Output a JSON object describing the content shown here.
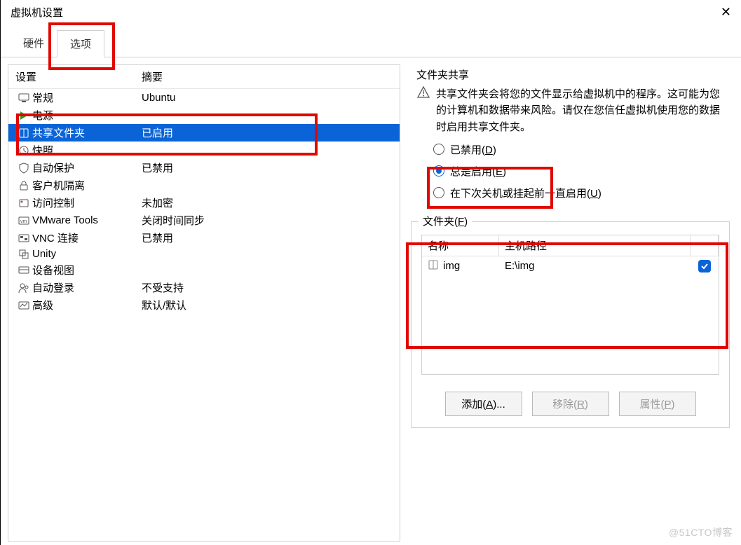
{
  "window_title": "虚拟机设置",
  "tabs": {
    "hardware": "硬件",
    "options": "选项"
  },
  "columns": {
    "setting": "设置",
    "summary": "摘要"
  },
  "settings": [
    {
      "key": "general",
      "label": "常规",
      "summary": "Ubuntu"
    },
    {
      "key": "power",
      "label": "电源",
      "summary": ""
    },
    {
      "key": "shared",
      "label": "共享文件夹",
      "summary": "已启用"
    },
    {
      "key": "snapshot",
      "label": "快照",
      "summary": ""
    },
    {
      "key": "autoprot",
      "label": "自动保护",
      "summary": "已禁用"
    },
    {
      "key": "guestiso",
      "label": "客户机隔离",
      "summary": ""
    },
    {
      "key": "access",
      "label": "访问控制",
      "summary": "未加密"
    },
    {
      "key": "vmtools",
      "label": "VMware Tools",
      "summary": "关闭时间同步"
    },
    {
      "key": "vnc",
      "label": "VNC 连接",
      "summary": "已禁用"
    },
    {
      "key": "unity",
      "label": "Unity",
      "summary": ""
    },
    {
      "key": "devview",
      "label": "设备视图",
      "summary": ""
    },
    {
      "key": "autologin",
      "label": "自动登录",
      "summary": "不受支持"
    },
    {
      "key": "advanced",
      "label": "高级",
      "summary": "默认/默认"
    }
  ],
  "sharing": {
    "section_title": "文件夹共享",
    "warning": "共享文件夹会将您的文件显示给虚拟机中的程序。这可能为您的计算机和数据带来风险。请仅在您信任虚拟机使用您的数据时启用共享文件夹。",
    "radio_disabled_pre": "已禁用(",
    "radio_disabled_u": "D",
    "radio_disabled_post": ")",
    "radio_always_pre": "总是启用(",
    "radio_always_u": "E",
    "radio_always_post": ")",
    "radio_until_pre": "在下次关机或挂起前一直启用(",
    "radio_until_u": "U",
    "radio_until_post": ")"
  },
  "folders": {
    "group_label_pre": "文件夹(",
    "group_label_u": "F",
    "group_label_post": ")",
    "col_name": "名称",
    "col_path": "主机路径",
    "row": {
      "name": "img",
      "path": "E:\\img"
    }
  },
  "buttons": {
    "add_pre": "添加(",
    "add_u": "A",
    "add_post": ")...",
    "remove_pre": "移除(",
    "remove_u": "R",
    "remove_post": ")",
    "props_pre": "属性(",
    "props_u": "P",
    "props_post": ")"
  },
  "watermark": "@51CTO博客"
}
